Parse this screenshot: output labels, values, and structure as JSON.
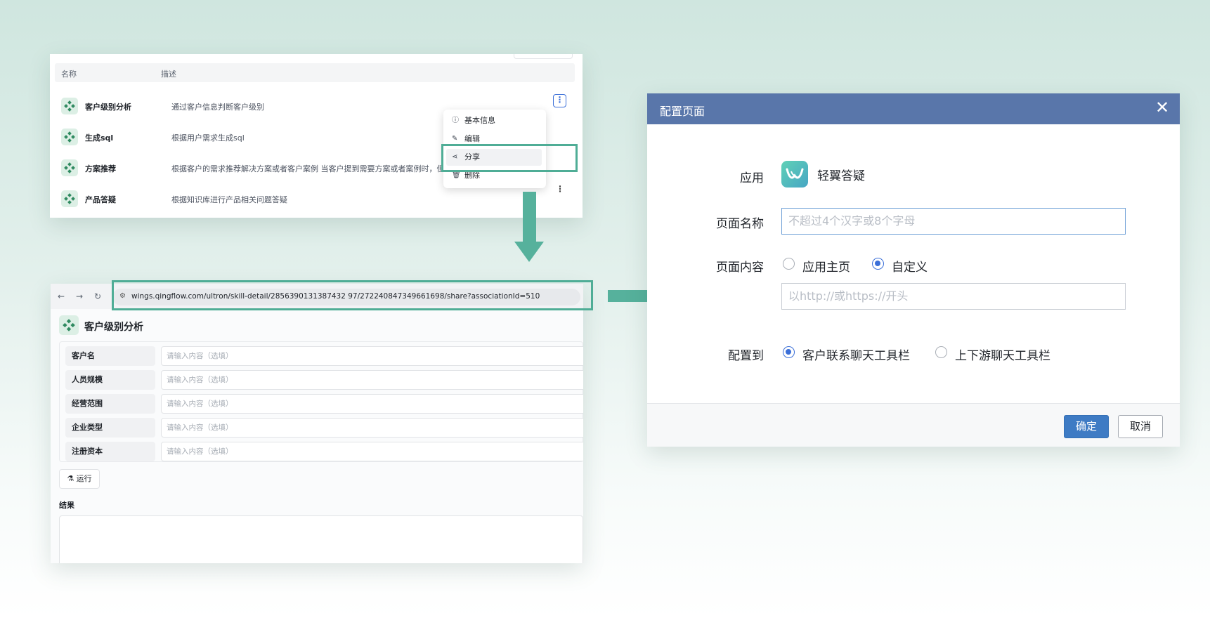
{
  "skill_list": {
    "columns": {
      "name": "名称",
      "description": "描述"
    },
    "rows": [
      {
        "name": "客户级别分析",
        "description": "通过客户信息判断客户级别"
      },
      {
        "name": "生成sql",
        "description": "根据用户需求生成sql"
      },
      {
        "name": "方案推荐",
        "description": "根据客户的需求推荐解决方案或者客户案例 当客户提到需要方案或者案例时，但"
      },
      {
        "name": "产品答疑",
        "description": "根据知识库进行产品相关问题答疑"
      }
    ],
    "more_icon": "⋮",
    "context_menu": [
      {
        "icon": "ⓘ",
        "label": "基本信息"
      },
      {
        "icon": "✎",
        "label": "编辑"
      },
      {
        "icon": "⋖",
        "label": "分享"
      },
      {
        "icon": "🗑",
        "label": "删除"
      }
    ]
  },
  "browser": {
    "back": "←",
    "forward": "→",
    "reload": "↻",
    "tune_icon": "⚙",
    "url": "wings.qingflow.com/ultron/skill-detail/2856390131387432 97/272240847349661698/share?associationId=510",
    "page_title": "客户级别分析",
    "fields": [
      {
        "label": "客户名",
        "placeholder": "请输入内容（选填）"
      },
      {
        "label": "人员规模",
        "placeholder": "请输入内容（选填）"
      },
      {
        "label": "经营范围",
        "placeholder": "请输入内容（选填）"
      },
      {
        "label": "企业类型",
        "placeholder": "请输入内容（选填）"
      },
      {
        "label": "注册资本",
        "placeholder": "请输入内容（选填）"
      }
    ],
    "run_button": "⚗ 运行",
    "result_label": "结果"
  },
  "dialog": {
    "title": "配置页面",
    "close": "✕",
    "app_label": "应用",
    "app_name": "轻翼答疑",
    "page_name_label": "页面名称",
    "page_name_placeholder": "不超过4个汉字或8个字母",
    "content_label": "页面内容",
    "content_options": [
      "应用主页",
      "自定义"
    ],
    "url_placeholder": "以http://或https://开头",
    "config_label": "配置到",
    "config_options": [
      "客户联系聊天工具栏",
      "上下游聊天工具栏"
    ],
    "ok_button": "确定",
    "cancel_button": "取消"
  },
  "colors": {
    "accent_green": "#56b19c",
    "dialog_header": "#5976aa",
    "primary_blue": "#3e7bc4"
  }
}
